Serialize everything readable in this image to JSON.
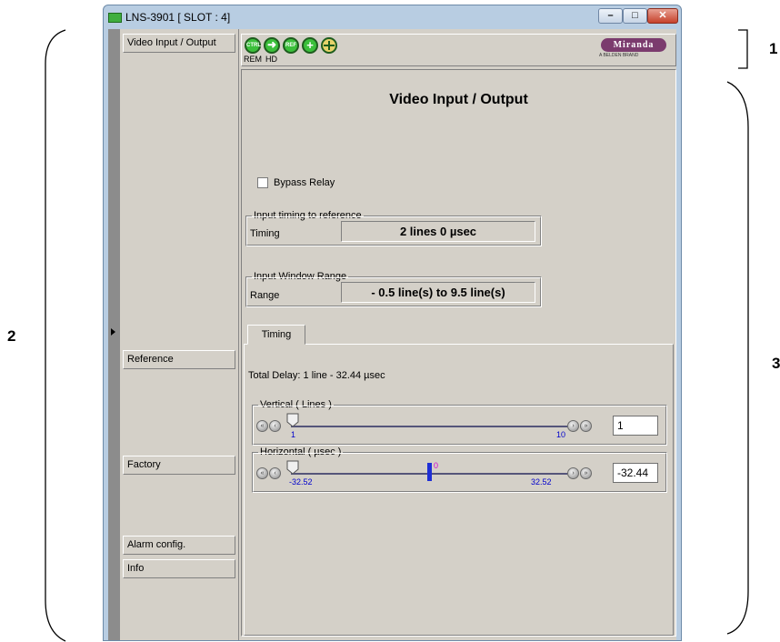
{
  "callouts": {
    "c1": "1",
    "c2": "2",
    "c3": "3"
  },
  "window": {
    "title": "LNS-3901 [ SLOT : 4]",
    "minimize_glyph": "–",
    "maximize_glyph": "□",
    "close_glyph": "✕"
  },
  "sidebar": {
    "items": [
      {
        "label": "Video Input / Output"
      },
      {
        "label": "Reference"
      },
      {
        "label": "Factory"
      },
      {
        "label": "Alarm config."
      },
      {
        "label": "Info"
      }
    ]
  },
  "toolbar": {
    "icons": [
      {
        "text": "CTRL",
        "label": "REM"
      },
      {
        "text": "",
        "label": "HD"
      },
      {
        "text": "REF",
        "label": ""
      },
      {
        "text": "+",
        "label": ""
      },
      {
        "text": "",
        "label": ""
      }
    ],
    "logo_text": "Miranda",
    "logo_sub": "A BELDEN BRAND"
  },
  "main": {
    "heading": "Video Input / Output",
    "bypass_label": "Bypass Relay",
    "timing_group": {
      "legend": "Input timing to reference",
      "label": "Timing",
      "value": "2 lines 0 µsec"
    },
    "window_group": {
      "legend": "Input Window Range",
      "label": "Range",
      "value": "- 0.5 line(s) to  9.5 line(s)"
    },
    "tab_label": "Timing",
    "total_delay": "Total Delay:  1 line  - 32.44 µsec",
    "vertical": {
      "legend": "Vertical ( Lines )",
      "min": "1",
      "max": "10",
      "value": "1"
    },
    "horizontal": {
      "legend": "Horizontal ( µsec )",
      "min": "-32.52",
      "max": "32.52",
      "zero": "0",
      "value": "-32.44"
    }
  },
  "colors": {
    "accent_green": "#3bbf3b",
    "logo_purple": "#7b3b6e",
    "slider_blue": "#1f2fd6"
  }
}
